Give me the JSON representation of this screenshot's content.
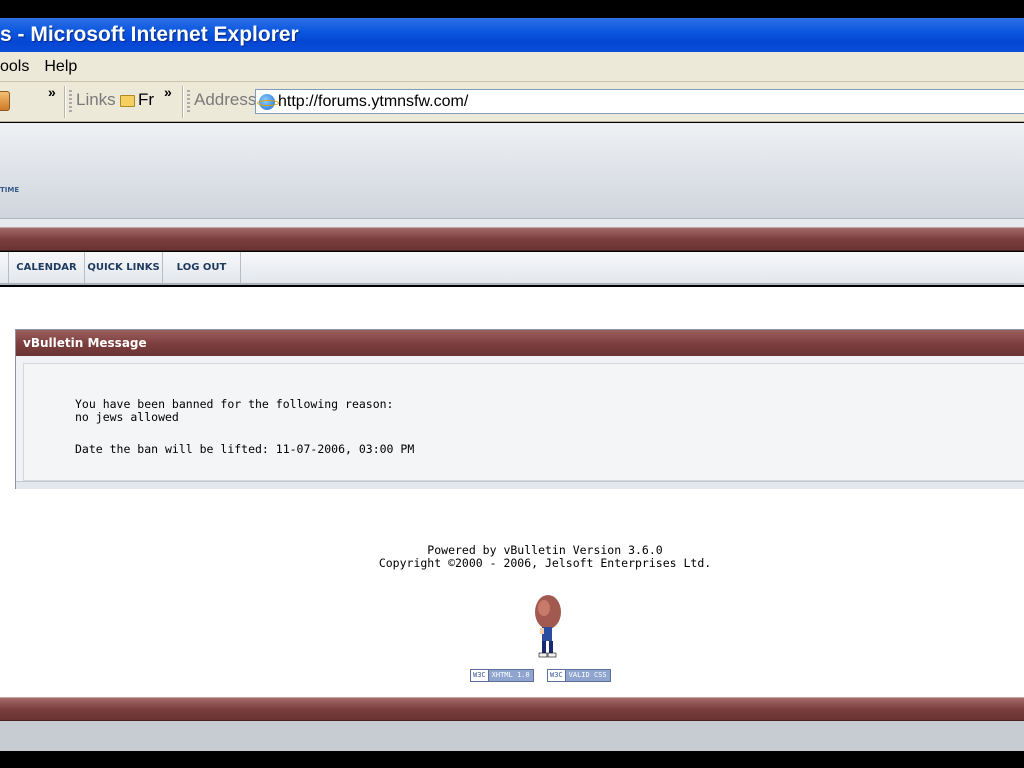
{
  "window": {
    "title": "s - Microsoft Internet Explorer"
  },
  "menu": {
    "items": [
      "ools",
      "Help"
    ]
  },
  "toolbar": {
    "links_label": "Links",
    "links_item": "Fr",
    "address_label": "Address",
    "address_value": "http://forums.ytmnsfw.com/",
    "chevron": "»"
  },
  "forum_header": {
    "time_text": "TIME"
  },
  "nav": {
    "items": [
      "CALENDAR",
      "QUICK LINKS",
      "LOG OUT"
    ]
  },
  "message": {
    "title": "vBulletin Message",
    "line1": "You have been banned for the following reason:",
    "line2": "no jews allowed",
    "line3": "Date the ban will be lifted: 11-07-2006, 03:00 PM"
  },
  "footer": {
    "powered_by": "Powered by vBulletin Version 3.6.0",
    "copyright": "Copyright ©2000 - 2006, Jelsoft Enterprises Ltd.",
    "badges": [
      {
        "w3c": "W3C",
        "label": "XHTML 1.0"
      },
      {
        "w3c": "W3C",
        "label": "VALID CSS"
      }
    ]
  },
  "colors": {
    "titlebar": "#0a58e0",
    "forum_maroon": "#7a3f3e",
    "nav_text": "#1e3a5f"
  }
}
